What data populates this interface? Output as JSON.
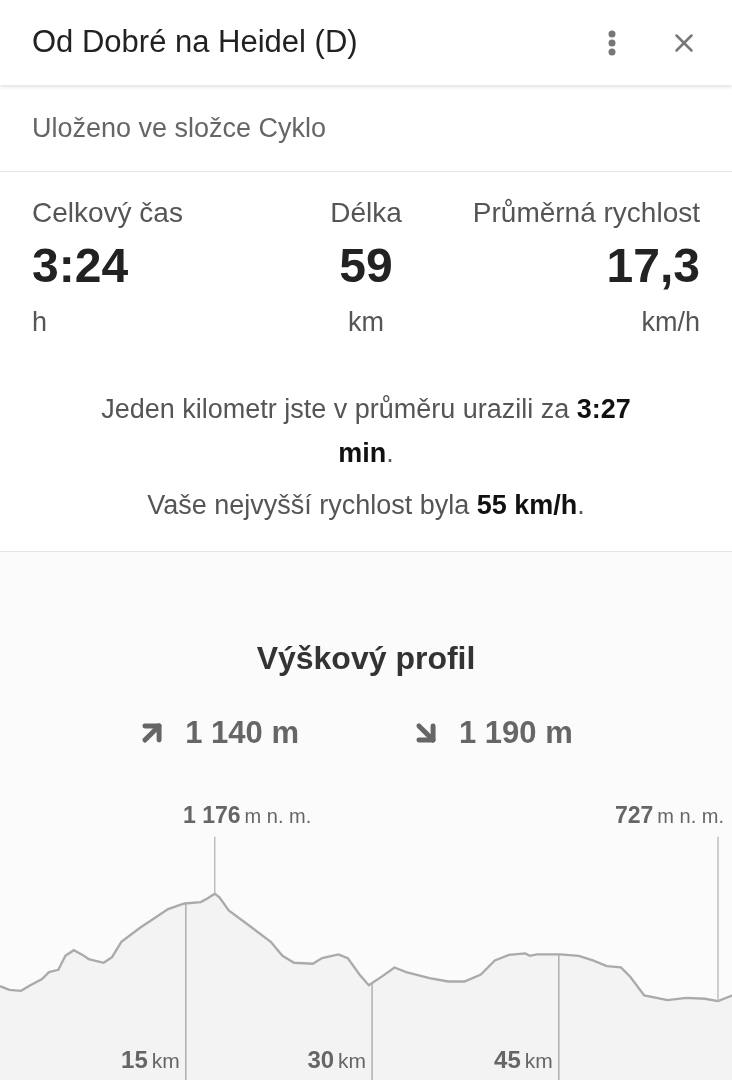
{
  "header": {
    "title": "Od Dobré na Heidel (D)"
  },
  "folder": "Uloženo ve složce Cyklo",
  "stats": [
    {
      "label": "Celkový čas",
      "value": "3:24",
      "unit": "h"
    },
    {
      "label": "Délka",
      "value": "59",
      "unit": "km"
    },
    {
      "label": "Průměrná rychlost",
      "value": "17,3",
      "unit": "km/h"
    }
  ],
  "summary": [
    "Jeden kilometr jste v průměru urazili za **3:27 min**.",
    "Vaše nejvyšší rychlost byla **55 km/h**."
  ],
  "elevation": {
    "title": "Výškový profil",
    "ascent": "1 140 m",
    "descent": "1 190 m",
    "altitude_marks": [
      {
        "value": "1 176",
        "unit": "m n. m."
      },
      {
        "value": "727",
        "unit": "m n. m."
      }
    ],
    "distance_marks": [
      {
        "value": "15",
        "unit": "km"
      },
      {
        "value": "30",
        "unit": "km"
      },
      {
        "value": "45",
        "unit": "km"
      }
    ]
  }
}
